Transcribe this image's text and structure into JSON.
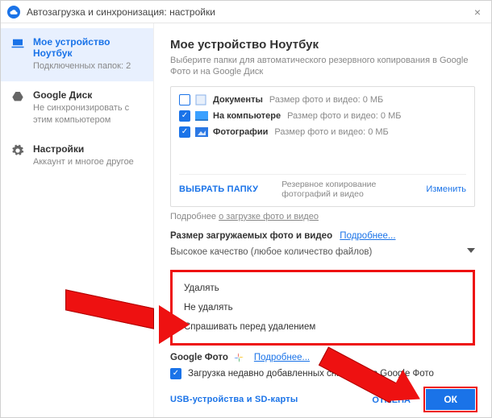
{
  "titlebar": {
    "title": "Автозагрузка и синхронизация: настройки"
  },
  "sidebar": {
    "items": [
      {
        "title": "Мое устройство Ноутбук",
        "sub": "Подключенных папок: 2"
      },
      {
        "title": "Google Диск",
        "sub": "Не синхронизировать с этим компьютером"
      },
      {
        "title": "Настройки",
        "sub": "Аккаунт и многое другое"
      }
    ]
  },
  "main": {
    "heading": "Мое устройство Ноутбук",
    "subtitle": "Выберите папки для автоматического резервного копирования в Google Фото и на Google Диск",
    "folders": [
      {
        "checked": false,
        "name": "Документы",
        "meta": "Размер фото и видео: 0 МБ",
        "iconColor": "#bcd3ee"
      },
      {
        "checked": true,
        "name": "На компьютере",
        "meta": "Размер фото и видео: 0 МБ",
        "iconColor": "#3aa0ff"
      },
      {
        "checked": true,
        "name": "Фотографии",
        "meta": "Размер фото и видео: 0 МБ",
        "iconColor": "#2b78e4"
      }
    ],
    "choose_folder": "ВЫБРАТЬ ПАПКУ",
    "footer_mid": "Резервное копирование фотографий и видео",
    "change": "Изменить",
    "more_prefix": "Подробнее ",
    "more_link": "о загрузке фото и видео",
    "size_title": "Размер загружаемых фото и видео",
    "more_label": "Подробнее...",
    "quality": "Высокое качество (любое количество файлов)",
    "delete_options": [
      "Удалять",
      "Не удалять",
      "Спрашивать перед удалением"
    ],
    "gp_label": "Google Фото",
    "gp_more": "Подробнее...",
    "gp_upload": "Загрузка недавно добавленных снимков и                в Google Фото",
    "usb_label": "USB-устройства и SD-карты",
    "cancel": "ОТМЕНА",
    "ok": "ОК"
  }
}
